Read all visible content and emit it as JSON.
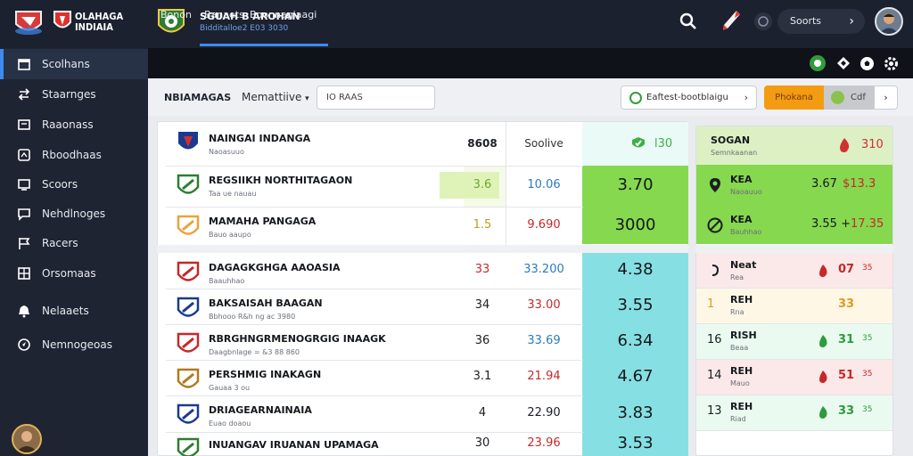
{
  "header": {
    "brand_line1": "OLAHAGA",
    "brand_line2": "INDIAIA",
    "title": "SGUAH B AROHAN",
    "subtitle": "Bidditalloe2 E03 3030",
    "sports_label": "Soorts",
    "sports_chevron": "›"
  },
  "sidebar": {
    "items": [
      {
        "label": "Scolhans",
        "icon": "calendar-icon",
        "active": true
      },
      {
        "label": "Staarnges",
        "icon": "swap-icon",
        "active": false
      },
      {
        "label": "Raaonass",
        "icon": "newspaper-icon",
        "active": false
      },
      {
        "label": "Rboodhaas",
        "icon": "dashboard-icon",
        "active": false
      },
      {
        "label": "Scoors",
        "icon": "monitor-icon",
        "active": false
      },
      {
        "label": "Nehdlnoges",
        "icon": "chat-icon",
        "active": false
      },
      {
        "label": "Racers",
        "icon": "flag-icon",
        "active": false
      },
      {
        "label": "Orsomaas",
        "icon": "grid-icon",
        "active": false
      },
      {
        "label": "Nelaaets",
        "icon": "bell-icon",
        "active": false
      },
      {
        "label": "Nemnogeoas",
        "icon": "compass-icon",
        "active": false
      }
    ]
  },
  "subnav": {
    "tabs": [
      "Bonon",
      "Banaets",
      "Boonnagiaagi"
    ]
  },
  "filters": {
    "label": "NBIAMAGAS",
    "dropdown": "Memattiive",
    "dropdown_chevron": "▾",
    "search_value": "IO RAAS",
    "select_value": "Eaftest-bootblaigu",
    "select_chevron": "›",
    "orange_label": "Phokana",
    "gray_label": "Cdf",
    "end_chevron": "›"
  },
  "table": {
    "header": {
      "team": "NAINGAI INDANGA",
      "sub": "Naoasuuo",
      "col1": "8608",
      "col2": "Soolive",
      "col3_value": "l30"
    },
    "rows": [
      {
        "team": "REGSIIKH NORTHITAGAON",
        "sub": "Taa ue nauau",
        "c1": "3.6",
        "c2": "10.06",
        "c3": "3.70"
      },
      {
        "team": "MAMAHA PANGAGA",
        "sub": "Bauo aaupo",
        "c1": "1.5",
        "c2": "9.690",
        "c3": "3000"
      },
      {
        "team": "DAGAGKGHGA AAOASIA",
        "sub": "Baauhhao",
        "c1": "33",
        "c2": "33.200",
        "c3": "4.38"
      },
      {
        "team": "BAKSAISAH BAAGAN",
        "sub": "Bbhooo R&h ng ac 3980",
        "c1": "34",
        "c2": "33.00",
        "c3": "3.55"
      },
      {
        "team": "RBRGHNGRMENOGRGIG INAAGK",
        "sub": "Daagbnlage  = &3 88 860",
        "c1": "36",
        "c2": "33.69",
        "c3": "6.34"
      },
      {
        "team": "PERSHMIG INAKAGN",
        "sub": "Gauaa 3 ou",
        "c1": "3.1",
        "c2": "21.94",
        "c3": "4.67"
      },
      {
        "team": "DRIAGEARNAINAIA",
        "sub": "Euao doaou",
        "c1": "4",
        "c2": "22.90",
        "c3": "3.83"
      },
      {
        "team": "INUANGAV IRUANAN UPAMAGA",
        "sub": "",
        "c1": "30",
        "c2": "23.96",
        "c3": "3.53"
      }
    ]
  },
  "side_table": {
    "header_title": "SOGAN",
    "header_sub": "Semnkaanan",
    "header_value": "310",
    "rows": [
      {
        "t": "KEA",
        "s": "Naoauuo",
        "v1": "3.67",
        "v2": "$13.3"
      },
      {
        "t": "KEA",
        "s": "Bauhhao",
        "v1": "3.55 +",
        "v2": "17.35"
      },
      {
        "t": "Neat",
        "s": "Rea",
        "prefix": "",
        "v1": "07",
        "v2": "35"
      },
      {
        "t": "REH",
        "s": "Rna",
        "prefix": "1",
        "v1": "33",
        "v2": ""
      },
      {
        "t": "RISH",
        "s": "Beaa",
        "prefix": "16",
        "v1": "31",
        "v2": "35"
      },
      {
        "t": "REH",
        "s": "Mauo",
        "prefix": "14",
        "v1": "51",
        "v2": "35"
      },
      {
        "t": "REH",
        "s": "Riad",
        "prefix": "13",
        "v1": "33",
        "v2": "35"
      }
    ]
  },
  "colors": {
    "accent": "#3d8bf0",
    "green": "#7ed957",
    "cyan": "#8ce3e6",
    "orange": "#f39c12"
  }
}
